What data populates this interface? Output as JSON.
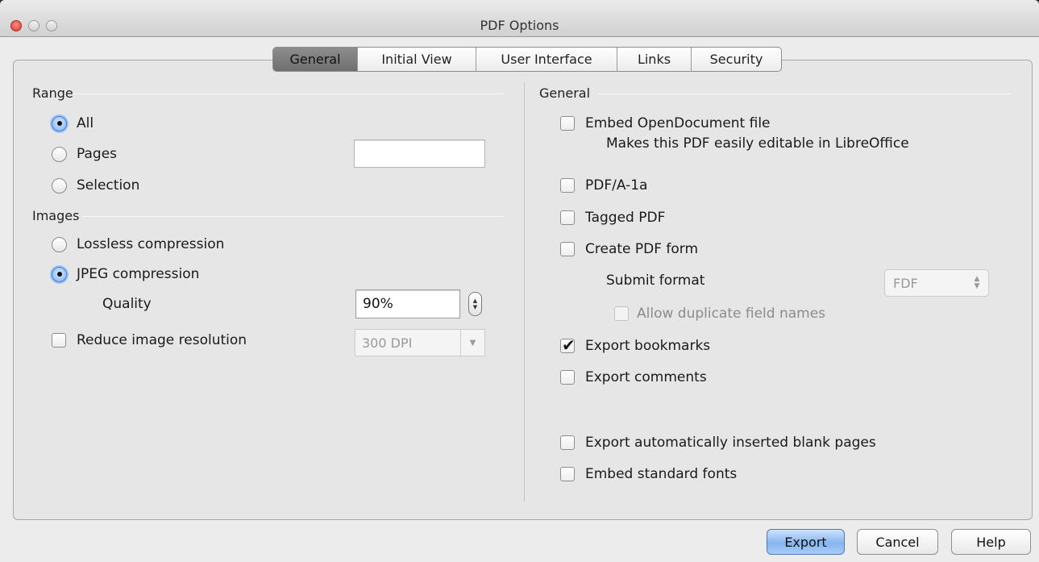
{
  "window": {
    "title": "PDF Options"
  },
  "tabs": [
    {
      "label": "General",
      "active": true
    },
    {
      "label": "Initial View",
      "active": false
    },
    {
      "label": "User Interface",
      "active": false
    },
    {
      "label": "Links",
      "active": false
    },
    {
      "label": "Security",
      "active": false
    }
  ],
  "range": {
    "title": "Range",
    "all_label": "All",
    "pages_label": "Pages",
    "pages_value": "",
    "selection_label": "Selection",
    "selected": "All"
  },
  "images": {
    "title": "Images",
    "lossless_label": "Lossless compression",
    "jpeg_label": "JPEG compression",
    "selected": "JPEG compression",
    "quality_label": "Quality",
    "quality_value": "90%",
    "reduce_label": "Reduce image resolution",
    "reduce_checked": false,
    "resolution_value": "300 DPI"
  },
  "general": {
    "title": "General",
    "embed_od_label": "Embed OpenDocument file",
    "embed_od_desc": "Makes this PDF easily editable in LibreOffice",
    "pdfa_label": "PDF/A-1a",
    "tagged_label": "Tagged PDF",
    "create_form_label": "Create PDF form",
    "submit_format_label": "Submit format",
    "submit_format_value": "FDF",
    "allow_dup_label": "Allow duplicate field names",
    "export_bookmarks_label": "Export bookmarks",
    "export_bookmarks_checked": true,
    "export_comments_label": "Export comments",
    "export_blank_label": "Export automatically inserted blank pages",
    "embed_fonts_label": "Embed standard fonts"
  },
  "buttons": {
    "export": "Export",
    "cancel": "Cancel",
    "help": "Help"
  },
  "colors": {
    "primary_button": "#86b5ef",
    "radio_selected": "#7fb0f2",
    "active_tab": "#7a7a7a"
  }
}
